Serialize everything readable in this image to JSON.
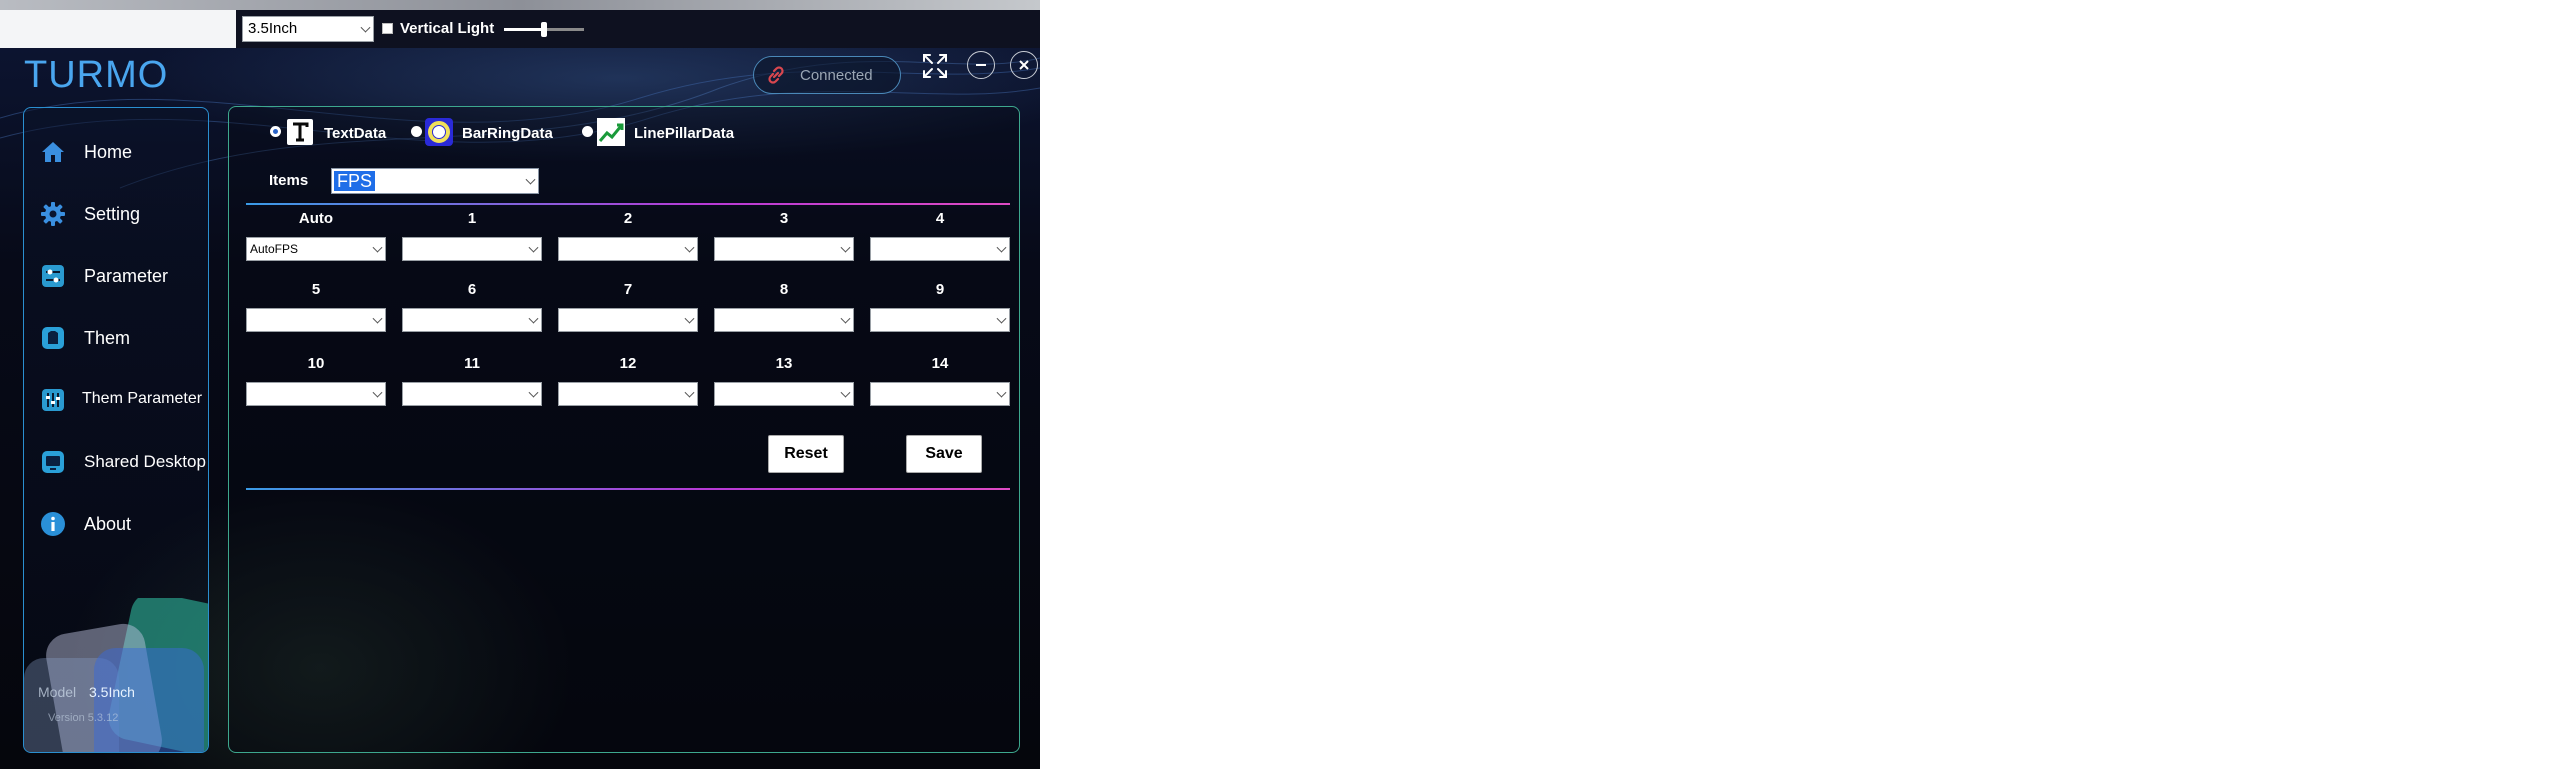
{
  "toolbar": {
    "size_select_value": "3.5Inch",
    "vertical_light_label": "Vertical Light",
    "vertical_light_level": 0.5
  },
  "app": {
    "logo": "TURMO",
    "connection_status": "Connected"
  },
  "sidebar": {
    "items": [
      {
        "label": "Home",
        "icon": "home-icon"
      },
      {
        "label": "Setting",
        "icon": "gear-icon"
      },
      {
        "label": "Parameter",
        "icon": "sliders-icon"
      },
      {
        "label": "Them",
        "icon": "theme-icon"
      },
      {
        "label": "Them Parameter",
        "icon": "equalizer-icon"
      },
      {
        "label": "Shared Desktop",
        "icon": "monitor-icon"
      },
      {
        "label": "About",
        "icon": "info-icon"
      }
    ],
    "model_label": "Model",
    "model_value": "3.5Inch",
    "version": "Version 5.3.12"
  },
  "data_type_tabs": [
    {
      "label": "TextData",
      "selected": true,
      "icon": "text-data-icon"
    },
    {
      "label": "BarRingData",
      "selected": false,
      "icon": "bar-ring-icon"
    },
    {
      "label": "LinePillarData",
      "selected": false,
      "icon": "line-chart-icon"
    }
  ],
  "items_label": "Items",
  "items_value": "FPS",
  "slots": [
    {
      "label": "Auto",
      "value": "AutoFPS"
    },
    {
      "label": "1",
      "value": ""
    },
    {
      "label": "2",
      "value": ""
    },
    {
      "label": "3",
      "value": ""
    },
    {
      "label": "4",
      "value": ""
    },
    {
      "label": "5",
      "value": ""
    },
    {
      "label": "6",
      "value": ""
    },
    {
      "label": "7",
      "value": ""
    },
    {
      "label": "8",
      "value": ""
    },
    {
      "label": "9",
      "value": ""
    },
    {
      "label": "10",
      "value": ""
    },
    {
      "label": "11",
      "value": ""
    },
    {
      "label": "12",
      "value": ""
    },
    {
      "label": "13",
      "value": ""
    },
    {
      "label": "14",
      "value": ""
    }
  ],
  "buttons": {
    "reset": "Reset",
    "save": "Save"
  },
  "colors": {
    "accent_blue": "#4aa6ef",
    "panel_border": "#3da88e",
    "sidebar_border": "#2a8fd0",
    "divider_start": "#3a9be6",
    "divider_end": "#de4ac4"
  }
}
